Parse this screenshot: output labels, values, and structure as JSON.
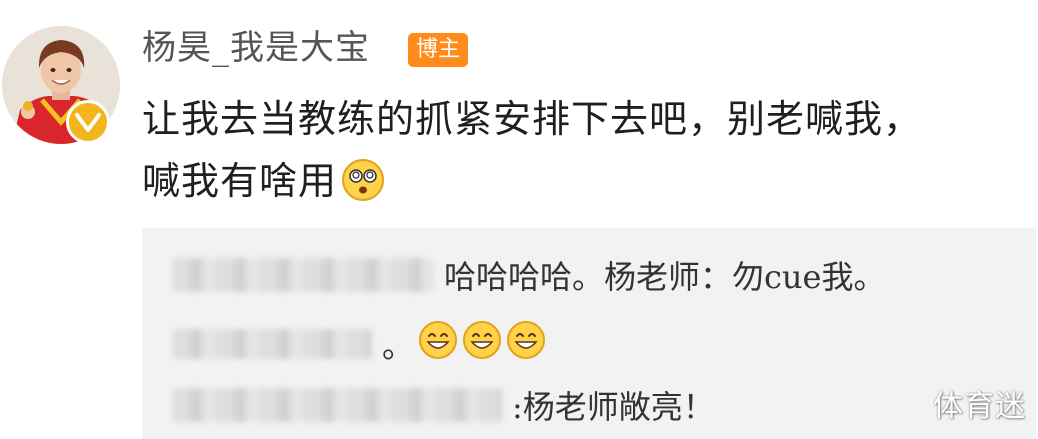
{
  "post": {
    "author": "杨昊_我是大宝",
    "author_badge": "博主",
    "text_line1": "让我去当教练的抓紧安排下去吧，别老喊我，",
    "text_line2": "喊我有啥用",
    "text_emoji": "dizzy-face-emoji"
  },
  "replies": [
    {
      "user_blurred": true,
      "text": "哈哈哈哈。杨老师：勿cue我。"
    },
    {
      "user_blurred": true,
      "text": "。",
      "emojis": [
        "grin-emoji",
        "grin-emoji",
        "grin-emoji"
      ]
    },
    {
      "user_blurred": true,
      "text": ":杨老师敞亮！"
    }
  ],
  "watermark": "体育迷",
  "colors": {
    "badge": "#ff8c1a",
    "verified": "#f3b51d",
    "reply_bg": "#f2f2f2"
  }
}
